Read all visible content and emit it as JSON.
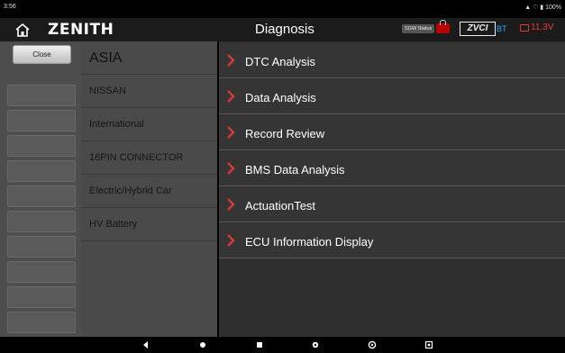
{
  "status_bar": {
    "time": "3:56",
    "indicators": "100%"
  },
  "header": {
    "brand": "ZENITH",
    "title": "Diagnosis",
    "sgw_label": "SGW Status",
    "vci_label": "ZVCI",
    "bt_label": "BT",
    "voltage": "11.3V"
  },
  "left_panel": {
    "close_label": "Close"
  },
  "breadcrumb": {
    "items": [
      {
        "label": "ASIA"
      },
      {
        "label": "NISSAN"
      },
      {
        "label": "International"
      },
      {
        "label": "16PIN CONNECTOR"
      },
      {
        "label": "Electric/Hybrid Car"
      },
      {
        "label": "HV Battery"
      }
    ]
  },
  "functions": {
    "items": [
      {
        "label": "DTC Analysis"
      },
      {
        "label": "Data Analysis"
      },
      {
        "label": "Record Review"
      },
      {
        "label": "BMS Data Analysis"
      },
      {
        "label": "ActuationTest"
      },
      {
        "label": "ECU Information Display"
      }
    ]
  },
  "colors": {
    "accent_red": "#e53935",
    "bt_blue": "#29a0ff"
  }
}
